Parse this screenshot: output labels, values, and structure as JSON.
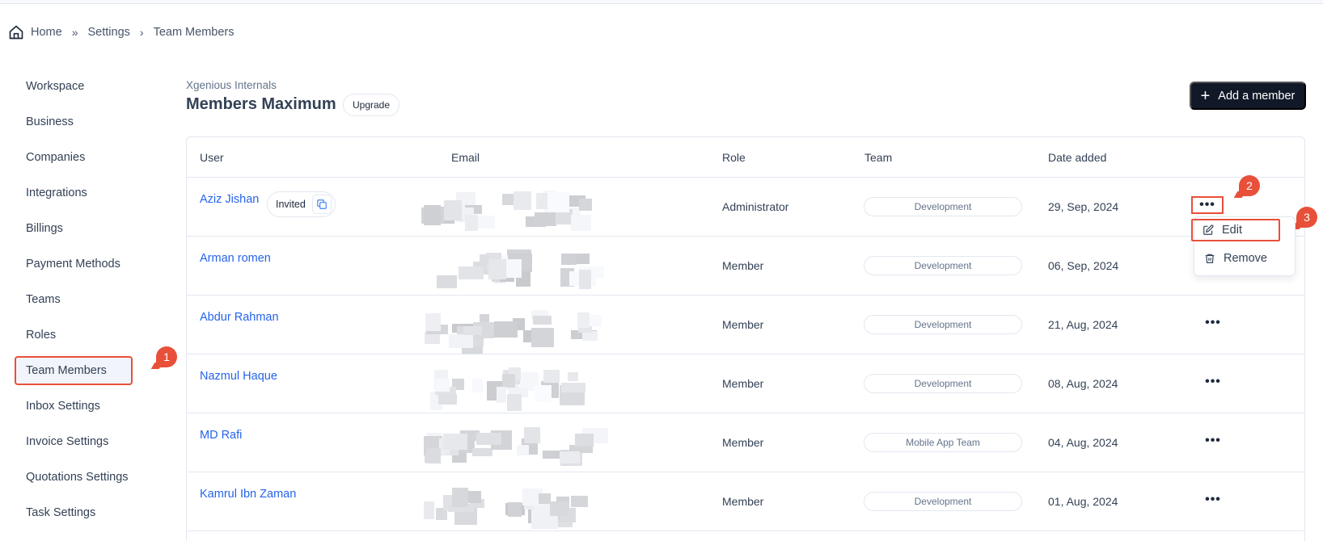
{
  "breadcrumb": {
    "items": [
      "Home",
      "Settings",
      "Team Members"
    ],
    "separators": [
      "»",
      "›"
    ]
  },
  "sidebar": {
    "items": [
      {
        "label": "Workspace"
      },
      {
        "label": "Business"
      },
      {
        "label": "Companies"
      },
      {
        "label": "Integrations"
      },
      {
        "label": "Billings"
      },
      {
        "label": "Payment Methods"
      },
      {
        "label": "Teams"
      },
      {
        "label": "Roles"
      },
      {
        "label": "Team Members",
        "active": true
      },
      {
        "label": "Inbox Settings"
      },
      {
        "label": "Invoice Settings"
      },
      {
        "label": "Quotations Settings"
      },
      {
        "label": "Task Settings"
      }
    ]
  },
  "header": {
    "org_name": "Xgenious Internals",
    "title": "Members Maximum",
    "upgrade_label": "Upgrade",
    "add_member_label": "Add a member"
  },
  "table": {
    "columns": [
      "User",
      "Email",
      "Role",
      "Team",
      "Date added"
    ],
    "rows": [
      {
        "name": "Aziz Jishan",
        "status": "Invited",
        "email": "",
        "role": "Administrator",
        "team": "Development",
        "date": "29, Sep, 2024"
      },
      {
        "name": "Arman romen",
        "email": "",
        "role": "Member",
        "team": "Development",
        "date": "06, Sep, 2024"
      },
      {
        "name": "Abdur Rahman",
        "email": "",
        "role": "Member",
        "team": "Development",
        "date": "21, Aug, 2024"
      },
      {
        "name": "Nazmul Haque",
        "email": "",
        "role": "Member",
        "team": "Development",
        "date": "08, Aug, 2024"
      },
      {
        "name": "MD Rafi",
        "email": "",
        "role": "Member",
        "team": "Mobile App Team",
        "date": "04, Aug, 2024"
      },
      {
        "name": "Kamrul Ibn Zaman",
        "email": "",
        "role": "Member",
        "team": "Development",
        "date": "01, Aug, 2024"
      }
    ],
    "more_icon": "•••"
  },
  "row_menu": {
    "items": [
      {
        "label": "Edit",
        "icon": "edit-icon"
      },
      {
        "label": "Remove",
        "icon": "trash-icon"
      }
    ]
  },
  "annotations": [
    "1",
    "2",
    "3"
  ],
  "colors": {
    "accent": "#e8503a",
    "primary_button": "#111827",
    "link": "#2563eb"
  }
}
